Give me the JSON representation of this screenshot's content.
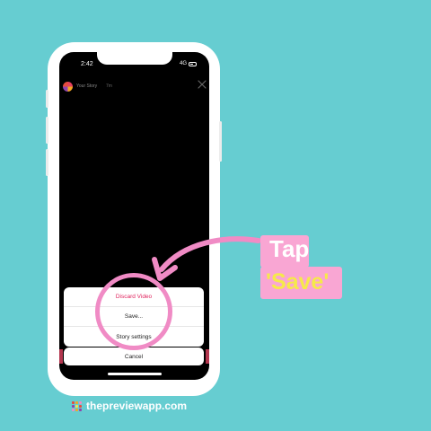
{
  "status_bar": {
    "time": "2:42",
    "network": "4G"
  },
  "story_header": {
    "label": "Your Story",
    "time_ago": "7m"
  },
  "action_sheet": {
    "items": [
      {
        "label": "Discard Video",
        "style": "destructive"
      },
      {
        "label": "Save..."
      },
      {
        "label": "Story settings"
      }
    ],
    "cancel_label": "Cancel"
  },
  "callout": {
    "line1": "Tap",
    "line2": "'Save'"
  },
  "footer": {
    "brand": "thepreviewapp.com"
  },
  "colors": {
    "background": "#66CDD1",
    "highlight_pink": "#F08BC5",
    "callout_bg": "#F9A6D3",
    "callout_accent": "#F6E94A",
    "destructive": "#e0245e"
  },
  "icons": [
    "close-icon",
    "battery-icon",
    "avatar",
    "brand-logo-icon"
  ]
}
